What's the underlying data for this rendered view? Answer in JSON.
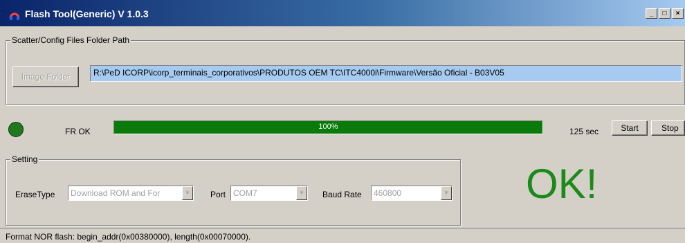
{
  "window": {
    "title": "Flash Tool(Generic) V 1.0.3",
    "controls": {
      "minimize": "_",
      "maximize": "□",
      "close": "×"
    }
  },
  "scatter_group": {
    "legend": "Scatter/Config Files Folder Path",
    "image_folder_button": "Image Folder",
    "path_value": "R:\\PeD ICORP\\icorp_terminais_corporativos\\PRODUTOS OEM TC\\ITC4000i\\Firmware\\Versão Oficial - B03V05"
  },
  "progress": {
    "status_label": "FR OK",
    "percent_text": "100%",
    "fraction": 1.0,
    "time_label": "125 sec",
    "start_button": "Start",
    "stop_button": "Stop"
  },
  "setting_group": {
    "legend": "Setting",
    "erase_type_label": "EraseType",
    "erase_type_value": "Download ROM and For",
    "port_label": "Port",
    "port_value": "COM7",
    "baud_rate_label": "Baud Rate",
    "baud_rate_value": "460800"
  },
  "result_text": "OK!",
  "status_bar": {
    "message": "Format NOR flash:  begin_addr(0x00380000), length(0x00070000)."
  },
  "colors": {
    "progress_green": "#008000",
    "ok_green": "#1b8a1b",
    "path_highlight": "#a6caf0"
  }
}
